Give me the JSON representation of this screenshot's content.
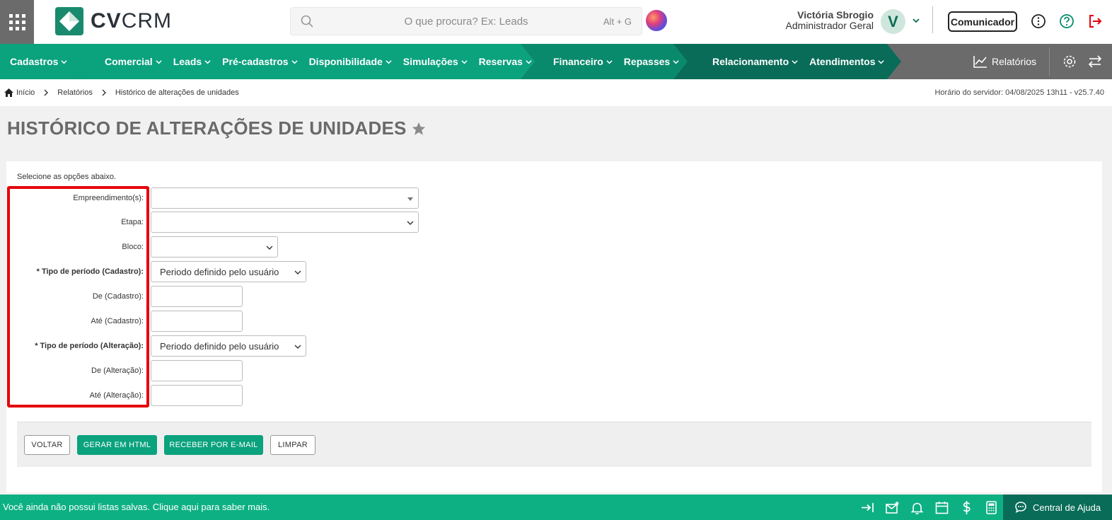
{
  "brand": {
    "logo_bold": "CV",
    "logo_light": "CRM"
  },
  "search": {
    "placeholder": "O que procura? Ex: Leads",
    "shortcut": "Alt + G"
  },
  "user": {
    "name": "Victória Sbrogio",
    "role": "Administrador Geral",
    "initial": "V"
  },
  "header": {
    "communicator_label": "Comunicador"
  },
  "nav": {
    "groups": [
      {
        "items": [
          "Cadastros"
        ],
        "color": "#0ba27e"
      },
      {
        "items": [
          "Comercial",
          "Leads",
          "Pré-cadastros",
          "Disponibilidade",
          "Simulações",
          "Reservas"
        ],
        "color": "#0ba27e"
      },
      {
        "items": [
          "Financeiro",
          "Repasses"
        ],
        "color": "#0a8a6c"
      },
      {
        "items": [
          "Relacionamento",
          "Atendimentos"
        ],
        "color": "#096c58"
      }
    ],
    "reports_label": "Relatórios"
  },
  "breadcrumb": {
    "items": [
      "Início",
      "Relatórios",
      "Histórico de alterações de unidades"
    ],
    "server_time": "Horário do servidor: 04/08/2025 13h11 - v25.7.40"
  },
  "page": {
    "title": "HISTÓRICO DE ALTERAÇÕES DE UNIDADES"
  },
  "form": {
    "intro": "Selecione as opções abaixo.",
    "fields": [
      {
        "label": "Empreendimento(s):",
        "value": "",
        "required": false
      },
      {
        "label": "Etapa:",
        "value": "",
        "required": false
      },
      {
        "label": "Bloco:",
        "value": "",
        "required": false
      },
      {
        "label": "* Tipo de período (Cadastro):",
        "value": "Periodo definido pelo usuário",
        "required": true
      },
      {
        "label": "De (Cadastro):",
        "value": "",
        "required": false
      },
      {
        "label": "Até (Cadastro):",
        "value": "",
        "required": false
      },
      {
        "label": "* Tipo de período (Alteração):",
        "value": "Periodo definido pelo usuário",
        "required": true
      },
      {
        "label": "De (Alteração):",
        "value": "",
        "required": false
      },
      {
        "label": "Até (Alteração):",
        "value": "",
        "required": false
      }
    ]
  },
  "actions": {
    "back": "VOLTAR",
    "html": "GERAR EM HTML",
    "email": "RECEBER POR E-MAIL",
    "clear": "LIMPAR"
  },
  "footer": {
    "message": "Você ainda não possui listas salvas. Clique aqui para saber mais.",
    "help_label": "Central de Ajuda"
  },
  "colors": {
    "primary_green": "#0ba27e",
    "footer_green": "#0db083",
    "highlight_red": "#e5000b"
  }
}
